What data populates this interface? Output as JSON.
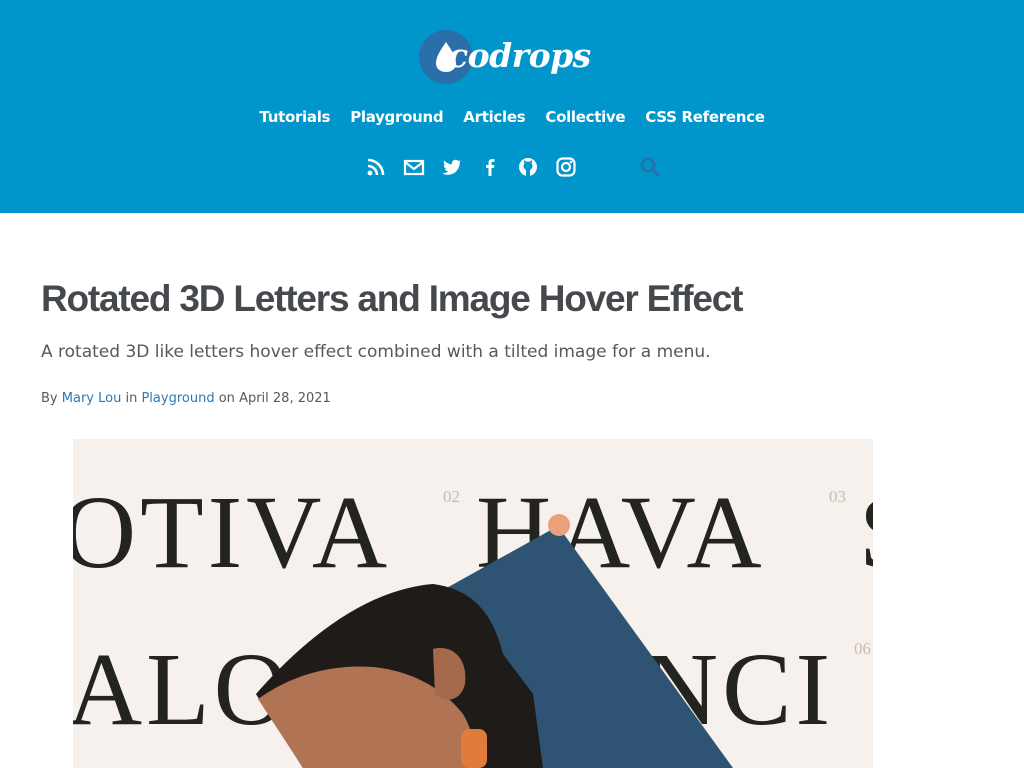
{
  "header": {
    "logo_text": "codrops",
    "nav": [
      "Tutorials",
      "Playground",
      "Articles",
      "Collective",
      "CSS Reference"
    ],
    "social_icons": [
      "rss-icon",
      "mail-icon",
      "twitter-icon",
      "facebook-icon",
      "github-icon",
      "instagram-icon"
    ],
    "search_icon": "search-icon"
  },
  "article": {
    "title": "Rotated 3D Letters and Image Hover Effect",
    "subtitle": "A rotated 3D like letters hover effect combined with a tilted image for a menu.",
    "meta": {
      "by": "By",
      "author": "Mary Lou",
      "in": "in",
      "category": "Playground",
      "on": "on",
      "date": "April 28, 2021"
    }
  },
  "hero": {
    "words": [
      "OTIVA",
      "HAVA",
      "ALO",
      "NCI"
    ],
    "numbers": [
      "02",
      "03",
      "06"
    ]
  },
  "colors": {
    "header_bg": "#0096cc",
    "link": "#2d79b3",
    "title": "#45484d",
    "hero_bg": "#f6f1ec"
  }
}
